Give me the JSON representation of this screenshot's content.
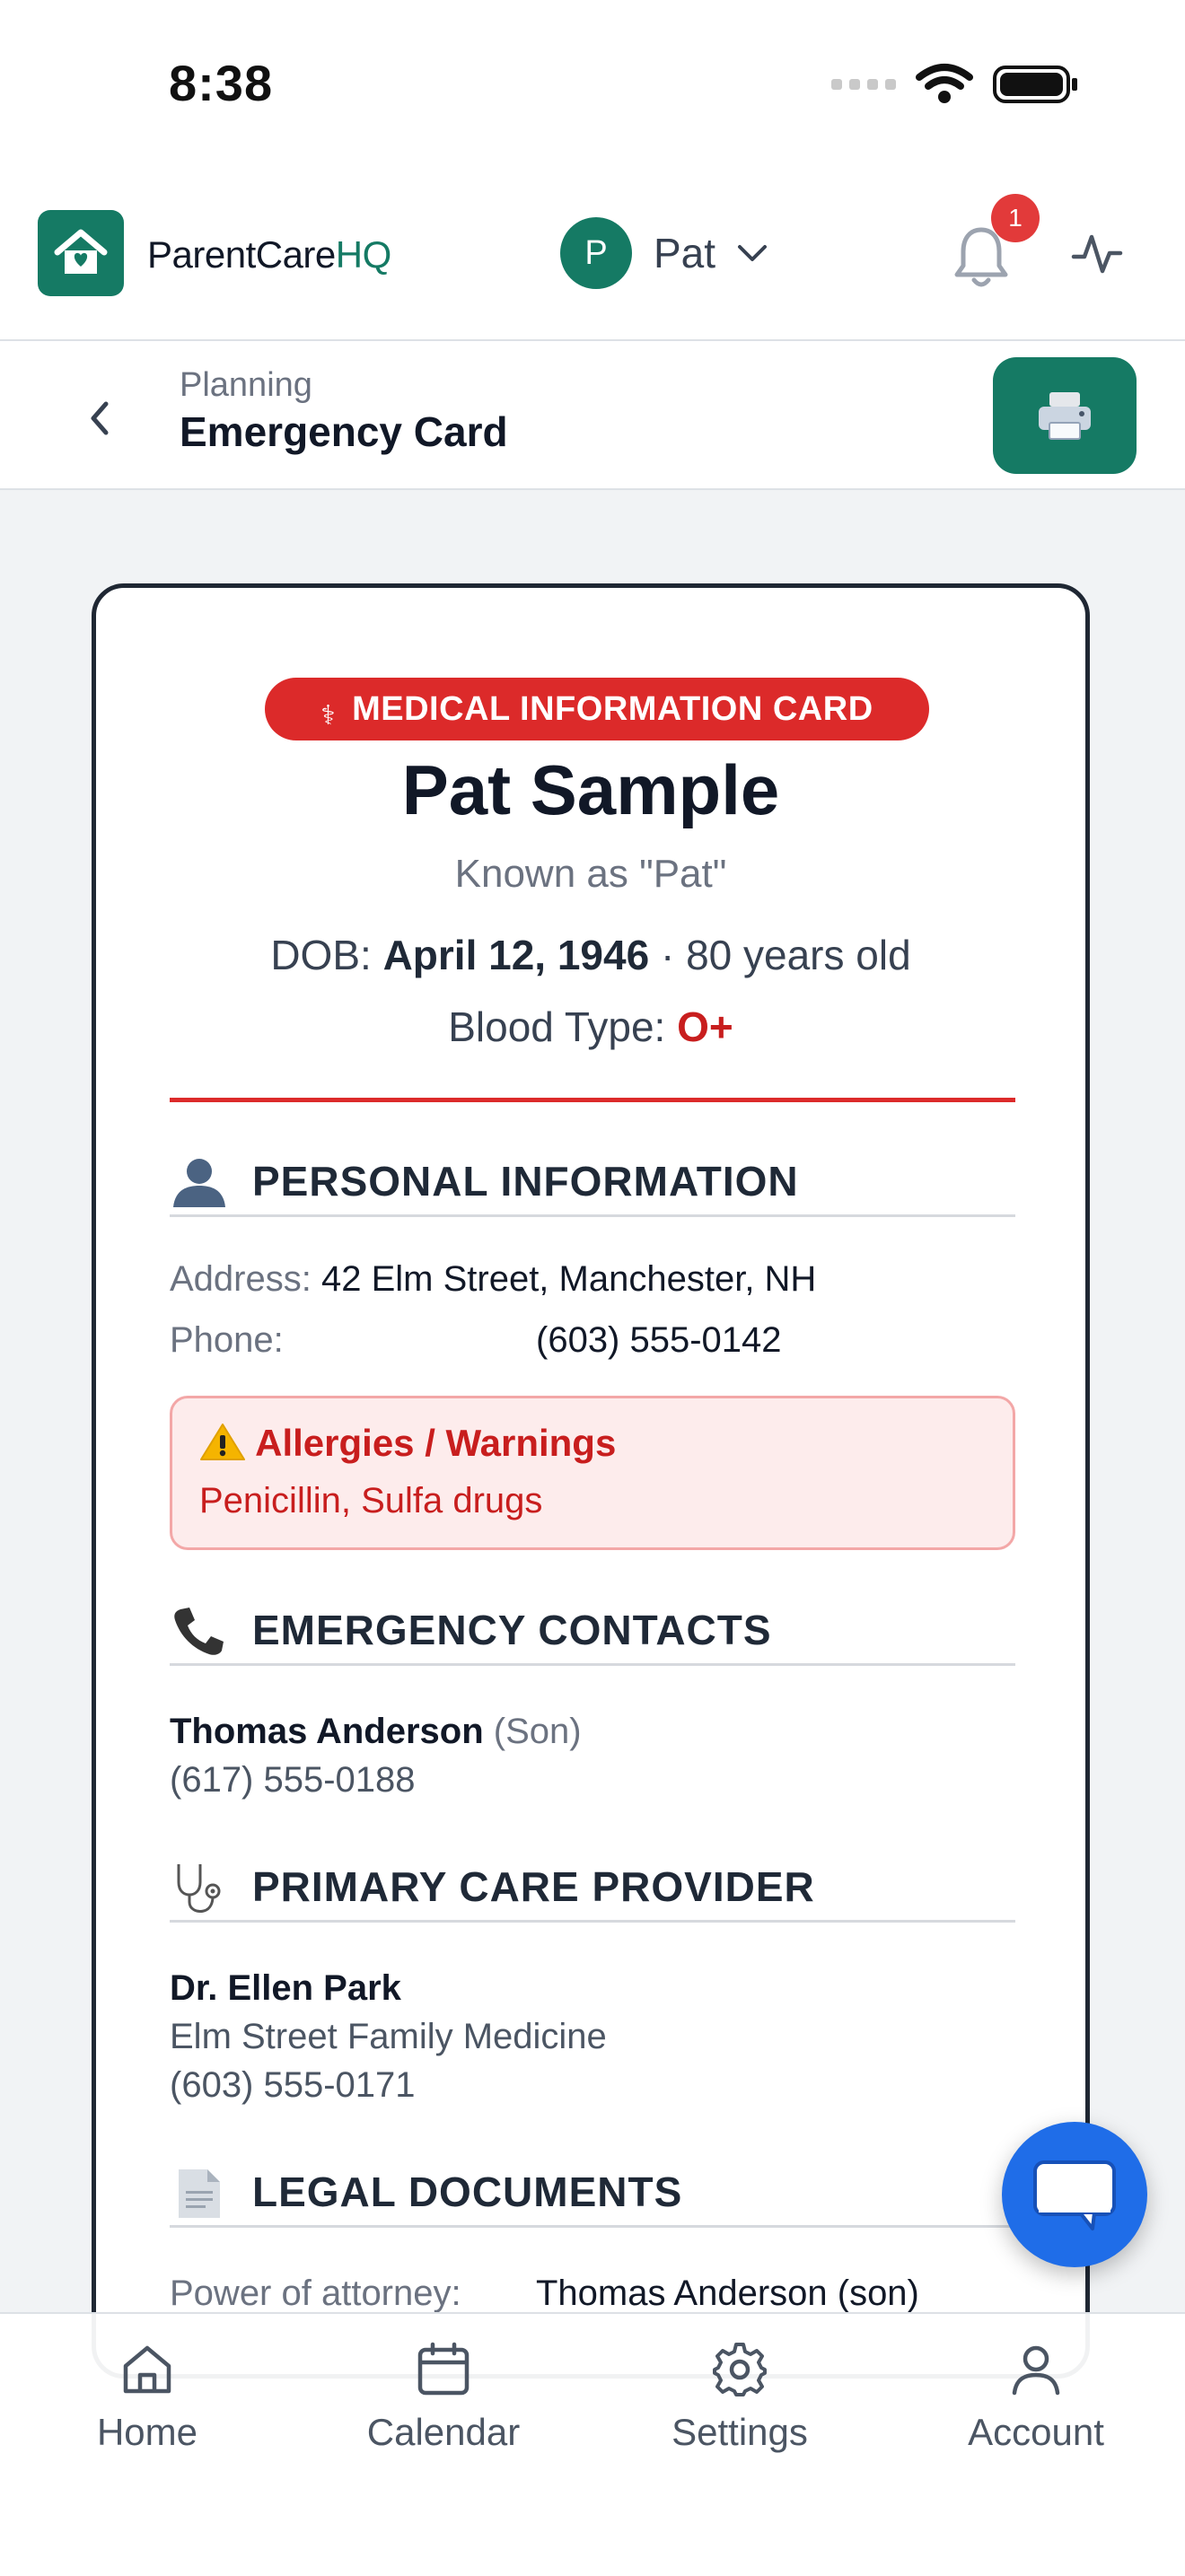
{
  "status_bar": {
    "time": "8:38"
  },
  "header": {
    "brand_main": "ParentCare",
    "brand_accent": "HQ",
    "profile_initial": "P",
    "profile_name": "Pat",
    "notification_count": "1",
    "accent_color": "#157a64"
  },
  "subheader": {
    "breadcrumb": "Planning",
    "title": "Emergency Card"
  },
  "card": {
    "badge": "MEDICAL INFORMATION CARD",
    "name": "Pat Sample",
    "known_as": "Known as \"Pat\"",
    "dob_label": "DOB: ",
    "dob_value": "April 12, 1946",
    "age": " · 80 years old",
    "blood_label": "Blood Type: ",
    "blood_value": "O+",
    "sections": {
      "personal": {
        "title": "PERSONAL INFORMATION",
        "address_label": "Address:",
        "address_value": "42 Elm Street, Manchester, NH",
        "phone_label": "Phone:",
        "phone_value": "(603) 555-0142",
        "warning_title": "Allergies / Warnings",
        "warning_text": "Penicillin, Sulfa drugs"
      },
      "contacts": {
        "title": "EMERGENCY CONTACTS",
        "contact_name": "Thomas Anderson",
        "contact_relation": " (Son)",
        "contact_phone": "(617) 555-0188"
      },
      "provider": {
        "title": "PRIMARY CARE PROVIDER",
        "name": "Dr. Ellen Park",
        "practice": "Elm Street Family Medicine",
        "phone": "(603) 555-0171"
      },
      "legal": {
        "title": "LEGAL DOCUMENTS",
        "poa_label": "Power of attorney:",
        "poa_value": "Thomas Anderson (son)"
      }
    }
  },
  "bottom_nav": {
    "home": "Home",
    "calendar": "Calendar",
    "settings": "Settings",
    "account": "Account"
  }
}
